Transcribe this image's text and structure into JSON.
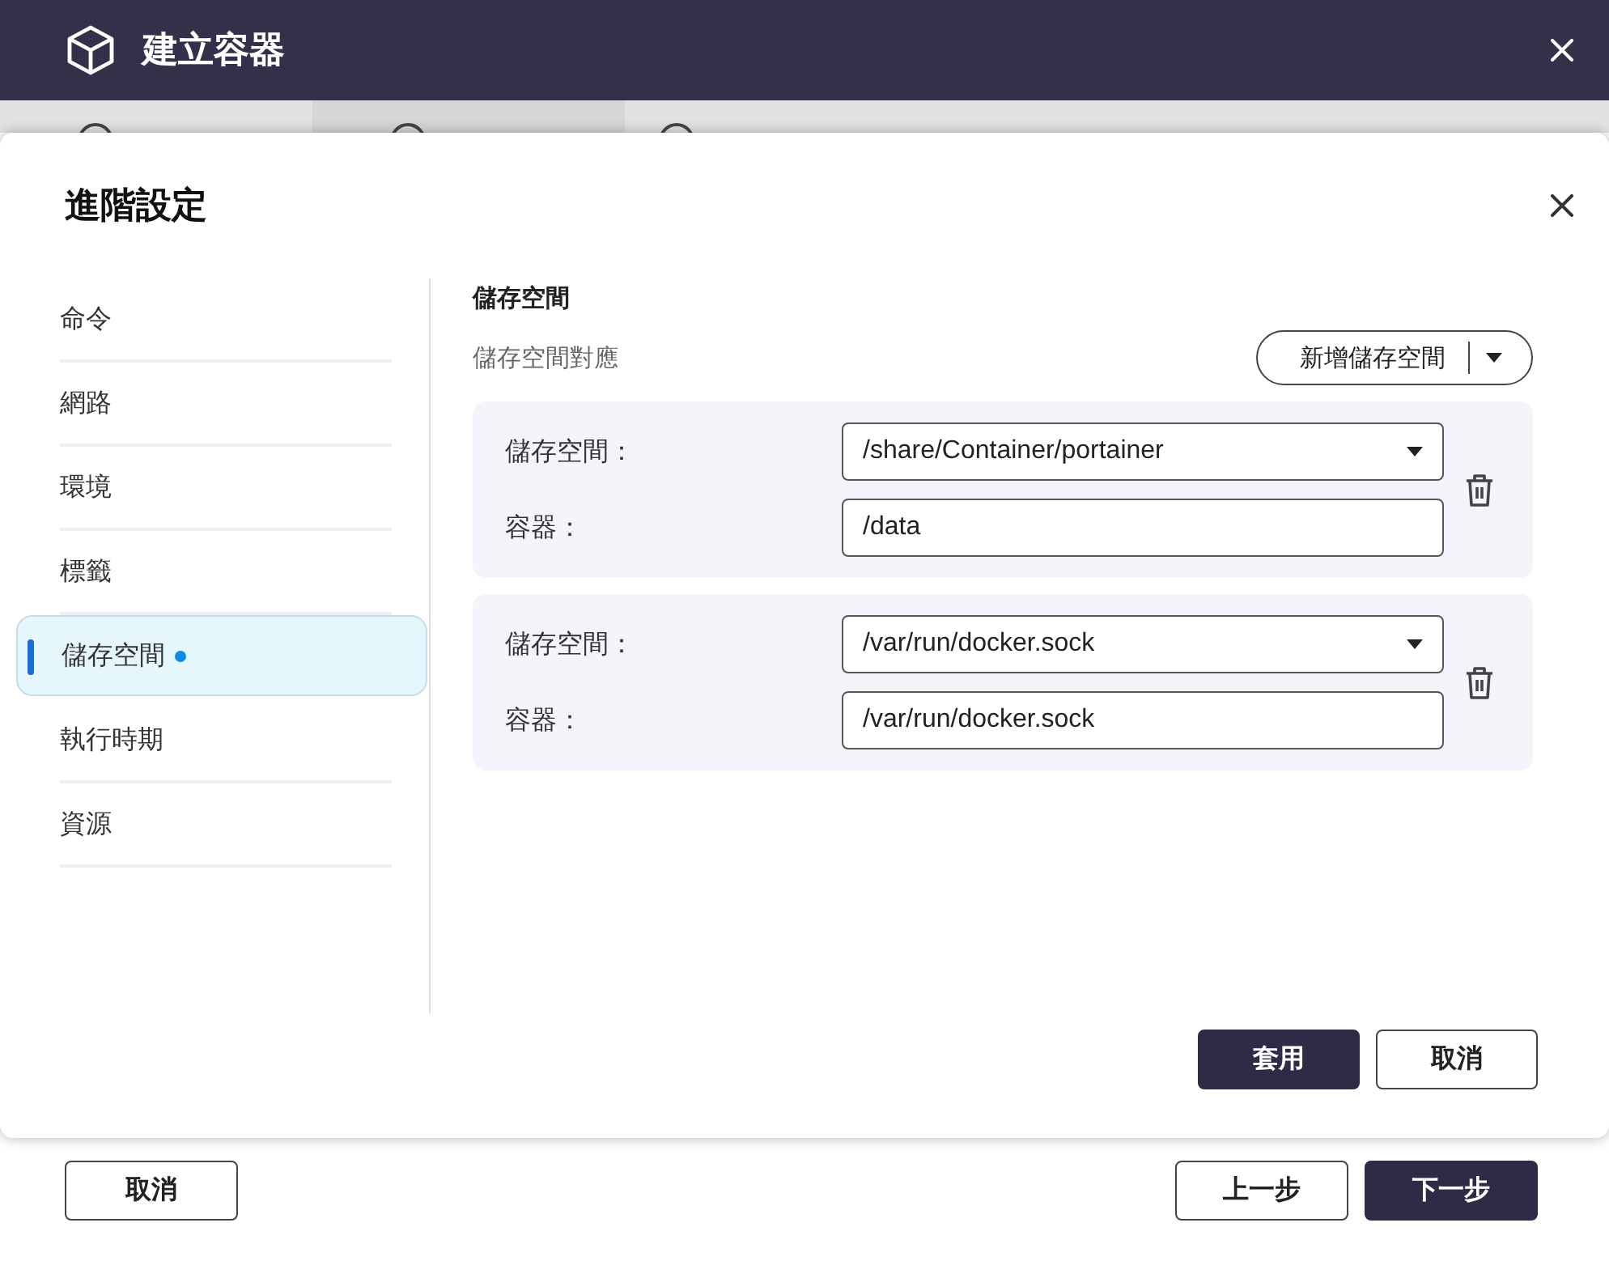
{
  "window": {
    "title": "建立容器"
  },
  "dialog": {
    "title": "進階設定",
    "sidebar": [
      {
        "label": "命令",
        "selected": false,
        "modified": false
      },
      {
        "label": "網路",
        "selected": false,
        "modified": false
      },
      {
        "label": "環境",
        "selected": false,
        "modified": false
      },
      {
        "label": "標籤",
        "selected": false,
        "modified": false
      },
      {
        "label": "儲存空間",
        "selected": true,
        "modified": true
      },
      {
        "label": "執行時期",
        "selected": false,
        "modified": false
      },
      {
        "label": "資源",
        "selected": false,
        "modified": false
      }
    ],
    "section": {
      "title": "儲存空間",
      "subtitle": "儲存空間對應",
      "add_button": "新增儲存空間",
      "mappings": [
        {
          "storage_label": "儲存空間：",
          "storage_value": "/share/Container/portainer",
          "container_label": "容器：",
          "container_value": "/data"
        },
        {
          "storage_label": "儲存空間：",
          "storage_value": "/var/run/docker.sock",
          "container_label": "容器：",
          "container_value": "/var/run/docker.sock"
        }
      ]
    },
    "buttons": [
      {
        "label": "套用",
        "kind": "primary"
      },
      {
        "label": "取消",
        "kind": "secondary"
      }
    ]
  },
  "footer": {
    "left_buttons": [
      {
        "label": "取消",
        "kind": "secondary"
      }
    ],
    "right_buttons": [
      {
        "label": "上一步",
        "kind": "secondary"
      },
      {
        "label": "下一步",
        "kind": "primary"
      }
    ]
  }
}
